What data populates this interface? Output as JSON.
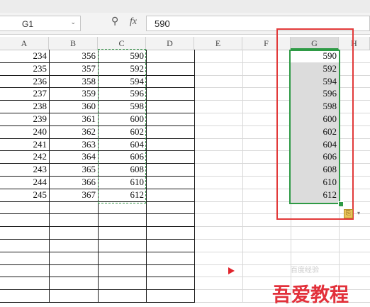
{
  "formula_bar": {
    "name_box": "G1",
    "name_box_arrow": "⌄",
    "zoom_glyph": "⚲",
    "fx_label": "fx",
    "formula_value": "590"
  },
  "columns": [
    "A",
    "B",
    "C",
    "D",
    "E",
    "F",
    "G",
    "H"
  ],
  "rows": [
    {
      "A": "234",
      "B": "356",
      "C": "590",
      "G": "590"
    },
    {
      "A": "235",
      "B": "357",
      "C": "592",
      "G": "592"
    },
    {
      "A": "236",
      "B": "358",
      "C": "594",
      "G": "594"
    },
    {
      "A": "237",
      "B": "359",
      "C": "596",
      "G": "596"
    },
    {
      "A": "238",
      "B": "360",
      "C": "598",
      "G": "598"
    },
    {
      "A": "239",
      "B": "361",
      "C": "600",
      "G": "600"
    },
    {
      "A": "240",
      "B": "362",
      "C": "602",
      "G": "602"
    },
    {
      "A": "241",
      "B": "363",
      "C": "604",
      "G": "604"
    },
    {
      "A": "242",
      "B": "364",
      "C": "606",
      "G": "606"
    },
    {
      "A": "243",
      "B": "365",
      "C": "608",
      "G": "608"
    },
    {
      "A": "244",
      "B": "366",
      "C": "610",
      "G": "610"
    },
    {
      "A": "245",
      "B": "367",
      "C": "612",
      "G": "612"
    }
  ],
  "paste_options_glyph": "⎘",
  "paste_options_arrow": "▾",
  "watermark": {
    "faint_text": "百度经验",
    "logo_text": "吾爱教程"
  },
  "colors": {
    "selection_border": "#2e9a45",
    "copy_marquee": "#3a9a4e",
    "highlight_box": "#e23a3a",
    "marker": "#e0242c"
  }
}
